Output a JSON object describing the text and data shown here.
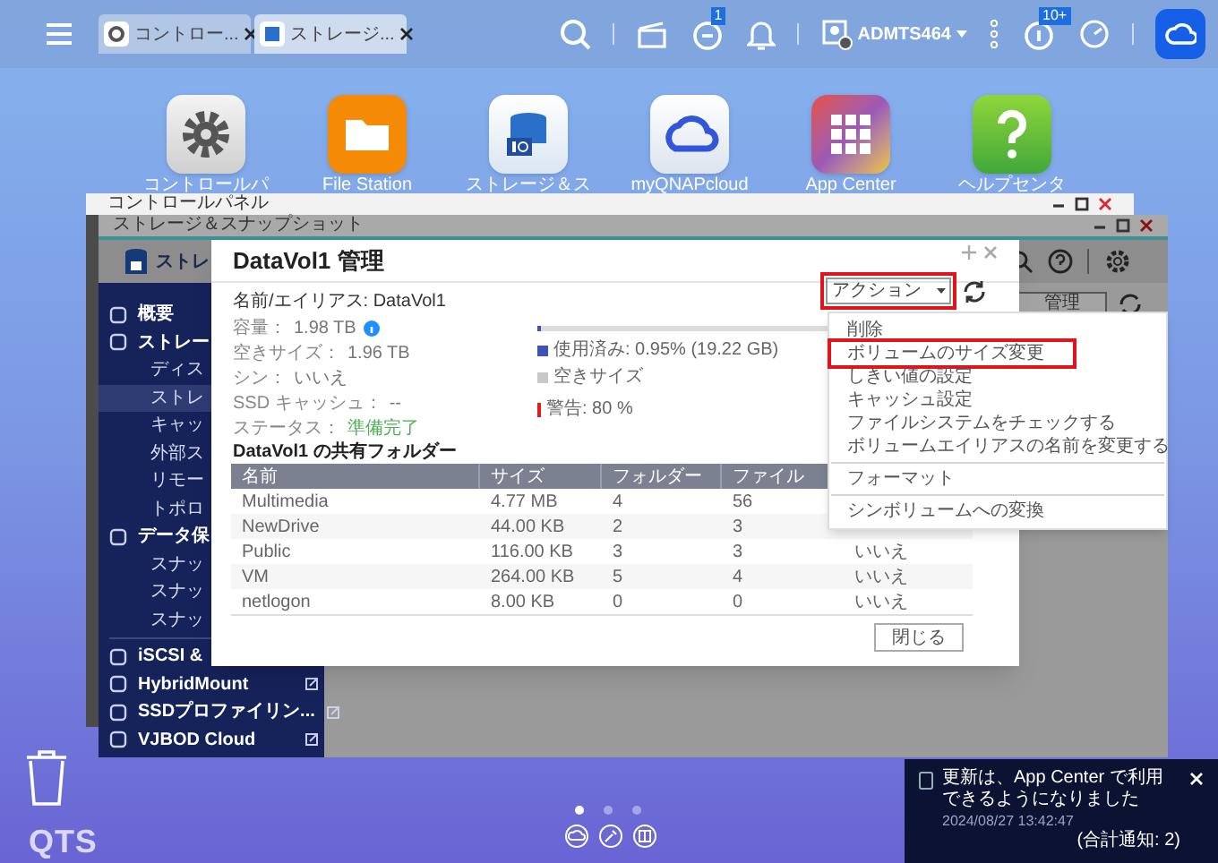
{
  "taskbar": {
    "tabs": [
      {
        "label": "コントロー...",
        "selected": false,
        "kind": "settings"
      },
      {
        "label": "ストレージ...",
        "selected": true,
        "kind": "storage"
      }
    ],
    "user": "ADMTS464",
    "sync_badge": "1",
    "info_badge": "10+"
  },
  "desktop_icons": [
    {
      "label": "コントロールパ",
      "kind": "settings"
    },
    {
      "label": "File Station",
      "kind": "folder"
    },
    {
      "label": "ストレージ＆ス",
      "kind": "storage"
    },
    {
      "label": "myQNAPcloud",
      "kind": "cloud"
    },
    {
      "label": "App Center",
      "kind": "apps"
    },
    {
      "label": "ヘルプセンタ",
      "kind": "help"
    }
  ],
  "control_panel": {
    "title": "コントロールパネル"
  },
  "storage_window": {
    "title": "ストレージ＆スナップショット",
    "header": "ストレ",
    "manage_button": "管理",
    "sidebar": [
      {
        "label": "概要",
        "kind": "section",
        "selected": false
      },
      {
        "label": "ストレー",
        "kind": "section",
        "selected": false
      },
      {
        "label": "ディス",
        "kind": "item",
        "selected": false
      },
      {
        "label": "ストレ",
        "kind": "item",
        "selected": true
      },
      {
        "label": "キャッ",
        "kind": "item",
        "selected": false
      },
      {
        "label": "外部ス",
        "kind": "item",
        "selected": false
      },
      {
        "label": "リモー",
        "kind": "item",
        "selected": false
      },
      {
        "label": "トポロ",
        "kind": "item",
        "selected": false
      },
      {
        "label": "データ保",
        "kind": "section",
        "selected": false
      },
      {
        "label": "スナッ",
        "kind": "item",
        "selected": false
      },
      {
        "label": "スナッ",
        "kind": "item",
        "selected": false
      },
      {
        "label": "スナッ",
        "kind": "item",
        "selected": false
      },
      {
        "label": "iSCSI &",
        "kind": "section",
        "selected": false
      },
      {
        "label": "HybridMount",
        "kind": "link",
        "selected": false
      },
      {
        "label": "SSDプロファイリン...",
        "kind": "link",
        "selected": false
      },
      {
        "label": "VJBOD Cloud",
        "kind": "link",
        "selected": false
      }
    ]
  },
  "dialog": {
    "title": "DataVol1  管理",
    "alias": "名前/エイリアス: DataVol1",
    "fields": [
      {
        "label": "容量：",
        "value": "1.98 TB",
        "kind": "info"
      },
      {
        "label": "空きサイズ：",
        "value": "1.96 TB",
        "kind": "plain"
      },
      {
        "label": "シン：",
        "value": "いいえ",
        "kind": "plain"
      },
      {
        "label": "SSD キャッシュ：",
        "value": "--",
        "kind": "plain"
      },
      {
        "label": "ステータス：",
        "value": "準備完了",
        "kind": "status"
      }
    ],
    "folders_heading": "DataVol1 の共有フォルダー",
    "action_button": "アクション",
    "usage": {
      "level": 0.0095,
      "used": "使用済み: 0.95% (19.22 GB)",
      "free": "空きサイズ",
      "warning": "警告: 80 %"
    },
    "table": {
      "columns": [
        "名前",
        "サイズ",
        "フォルダー",
        "ファイル"
      ],
      "rows": [
        [
          "Multimedia",
          "4.77 MB",
          "4",
          "56"
        ],
        [
          "NewDrive",
          "44.00 KB",
          "2",
          "3"
        ],
        [
          "Public",
          "116.00 KB",
          "3",
          "3",
          "いいえ"
        ],
        [
          "VM",
          "264.00 KB",
          "5",
          "4",
          "いいえ"
        ],
        [
          "netlogon",
          "8.00 KB",
          "0",
          "0",
          "いいえ"
        ]
      ]
    },
    "close_button": "閉じる"
  },
  "action_menu": [
    {
      "label": "削除",
      "highlighted": false,
      "divider_before": false
    },
    {
      "label": "ボリュームのサイズ変更",
      "highlighted": true,
      "divider_before": false
    },
    {
      "label": "しきい値の設定",
      "highlighted": false,
      "divider_before": false
    },
    {
      "label": "キャッシュ設定",
      "highlighted": false,
      "divider_before": false
    },
    {
      "label": "ファイルシステムをチェックする",
      "highlighted": false,
      "divider_before": false
    },
    {
      "label": "ボリュームエイリアスの名前を変更する",
      "highlighted": false,
      "divider_before": false
    },
    {
      "label": "フォーマット",
      "highlighted": false,
      "divider_before": true
    },
    {
      "label": "シンボリュームへの変換",
      "highlighted": false,
      "divider_before": true
    }
  ],
  "desktop": {
    "logo": "QTS",
    "pages": [
      {
        "selected": true
      },
      {
        "selected": false
      },
      {
        "selected": false
      }
    ]
  },
  "notification": {
    "message": "更新は、App Center で利用できるようになりました",
    "time": "2024/08/27 13:42:47",
    "total": "(合計通知: 2)"
  }
}
